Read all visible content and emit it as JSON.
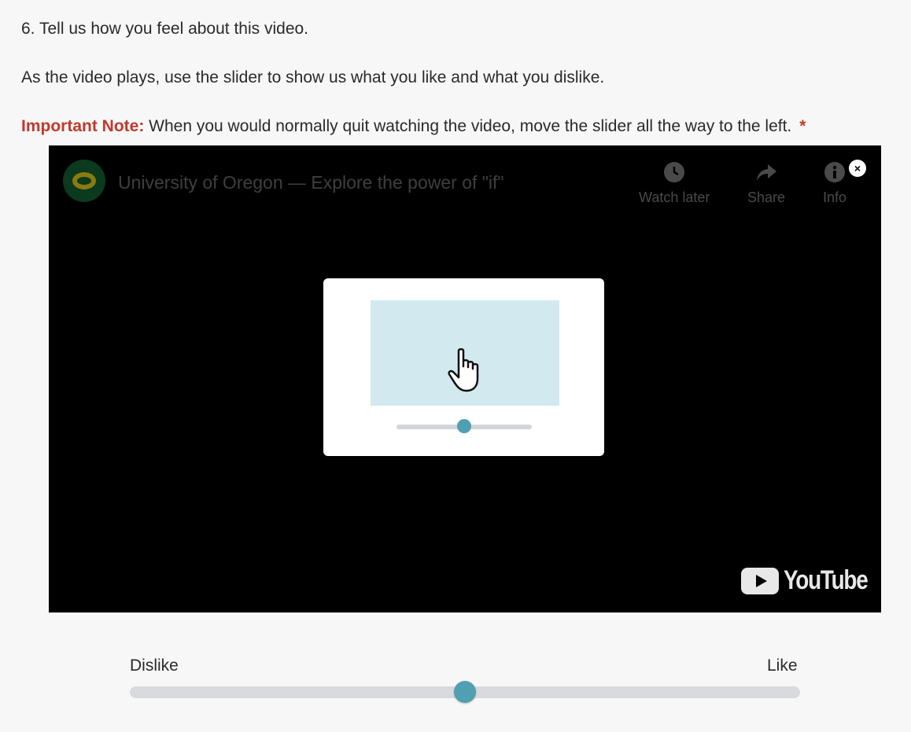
{
  "question": {
    "number_text": "6. Tell us how you feel about this video.",
    "instruction": "As the video plays, use the slider to show us what you like and what you dislike.",
    "note_label": "Important Note:",
    "note_text": " When you would normally quit watching the video, move the slider all the way to the left.",
    "required_marker": "*"
  },
  "video": {
    "title": "University of Oregon — Explore the power of \"if\"",
    "actions": {
      "watch_later": "Watch later",
      "share": "Share",
      "info": "Info"
    },
    "close_symbol": "×",
    "platform_logo_text": "YouTube",
    "icons": [
      "channel-logo",
      "clock-icon",
      "share-arrow-icon",
      "info-icon",
      "close-icon",
      "hand-pointer-icon",
      "youtube-play-icon"
    ],
    "overlay_slider_value": 0.5
  },
  "slider": {
    "left_label": "Dislike",
    "right_label": "Like",
    "value": 0.5
  },
  "colors": {
    "accent": "#4fa0b0",
    "note": "#c0392b",
    "overlay_screen": "#d1e9ef"
  }
}
